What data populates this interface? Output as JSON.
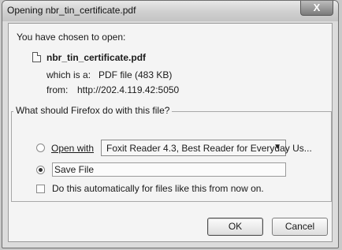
{
  "window": {
    "title": "Opening nbr_tin_certificate.pdf",
    "close_symbol": "X"
  },
  "intro": "You have chosen to open:",
  "file": {
    "icon": "document-icon",
    "name": "nbr_tin_certificate.pdf",
    "type_label": "which is a:",
    "type_value": "PDF file (483 KB)",
    "from_label": "from:",
    "from_value": "http://202.4.119.42:5050"
  },
  "question": "What should Firefox do with this file?",
  "options": {
    "open_with_label": "Open with",
    "open_with_selected": "Foxit Reader 4.3, Best Reader for Everyday Us...",
    "save_file_label": "Save File",
    "selected": "save_file"
  },
  "auto_checkbox": {
    "label": "Do this automatically for files like this from now on.",
    "checked": false
  },
  "buttons": {
    "ok": "OK",
    "cancel": "Cancel"
  }
}
